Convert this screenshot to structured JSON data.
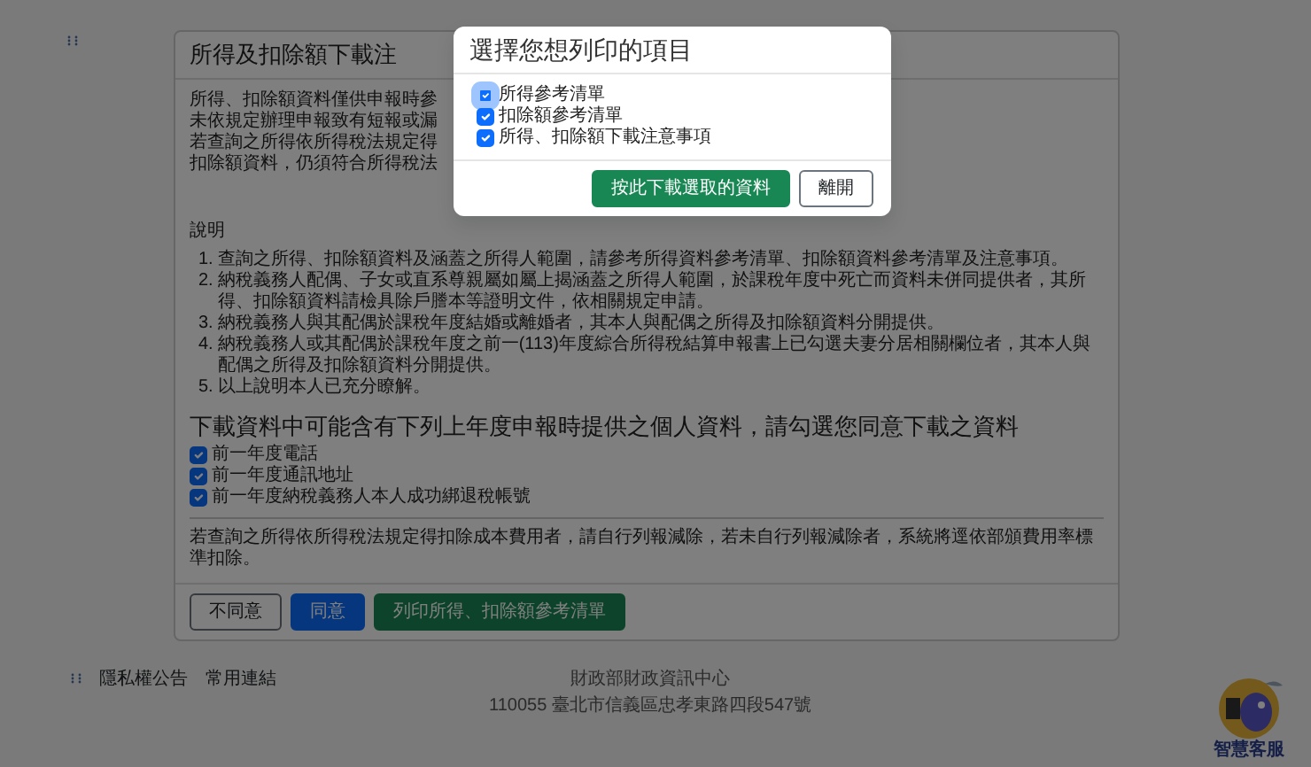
{
  "card": {
    "title": "所得及扣除額下載注",
    "intro_lines": [
      "所得、扣除額資料僅供申報時參",
      "未依規定辦理申報致有短報或漏",
      "若查詢之所得依所得稅法規定得",
      "扣除額資料，仍須符合所得稅法"
    ],
    "notes_label": "說明",
    "notes": [
      {
        "marker": "1.",
        "text": "查詢之所得、扣除額資料及涵蓋之所得人範圍，請參考所得資料參考清單、扣除額資料參考清單及注意事項。"
      },
      {
        "marker": "2.",
        "text": "納稅義務人配偶、子女或直系尊親屬如屬上揭涵蓋之所得人範圍，於課稅年度中死亡而資料未併同提供者，其所得、扣除額資料請檢具除戶謄本等證明文件，依相關規定申請。"
      },
      {
        "marker": "3.",
        "text": "納稅義務人與其配偶於課稅年度結婚或離婚者，其本人與配偶之所得及扣除額資料分開提供。"
      },
      {
        "marker": "4.",
        "text": "納稅義務人或其配偶於課稅年度之前一(113)年度綜合所得稅結算申報書上已勾選夫妻分居相關欄位者，其本人與配偶之所得及扣除額資料分開提供。"
      },
      {
        "marker": "5.",
        "text": "以上說明本人已充分瞭解。"
      }
    ],
    "consent_heading": "下載資料中可能含有下列上年度申報時提供之個人資料，請勾選您同意下載之資料",
    "consent_items": [
      {
        "label": "前一年度電話",
        "checked": true
      },
      {
        "label": "前一年度通訊地址",
        "checked": true
      },
      {
        "label": "前一年度納稅義務人本人成功綁退稅帳號",
        "checked": true
      }
    ],
    "cost_note": "若查詢之所得依所得稅法規定得扣除成本費用者，請自行列報減除，若未自行列報減除者，系統將逕依部頒費用率標準扣除。",
    "buttons": [
      {
        "label": "不同意",
        "kind": "outline"
      },
      {
        "label": "同意",
        "kind": "primary"
      },
      {
        "label": "列印所得、扣除額參考清單",
        "kind": "success"
      }
    ]
  },
  "footer": {
    "links": [
      "隱私權公告",
      "常用連結"
    ],
    "org": "財政部財政資訊中心",
    "address": "110055 臺北市信義區忠孝東路四段547號"
  },
  "chatbot": {
    "label": "智慧客服"
  },
  "modal": {
    "title": "選擇您想列印的項目",
    "options": [
      {
        "label": "所得參考清單",
        "checked": true,
        "focused": true
      },
      {
        "label": "扣除額參考清單",
        "checked": true,
        "focused": false
      },
      {
        "label": "所得、扣除額下載注意事項",
        "checked": true,
        "focused": false
      }
    ],
    "buttons": [
      {
        "label": "按此下載選取的資料",
        "kind": "success"
      },
      {
        "label": "離開",
        "kind": "outline"
      }
    ]
  }
}
